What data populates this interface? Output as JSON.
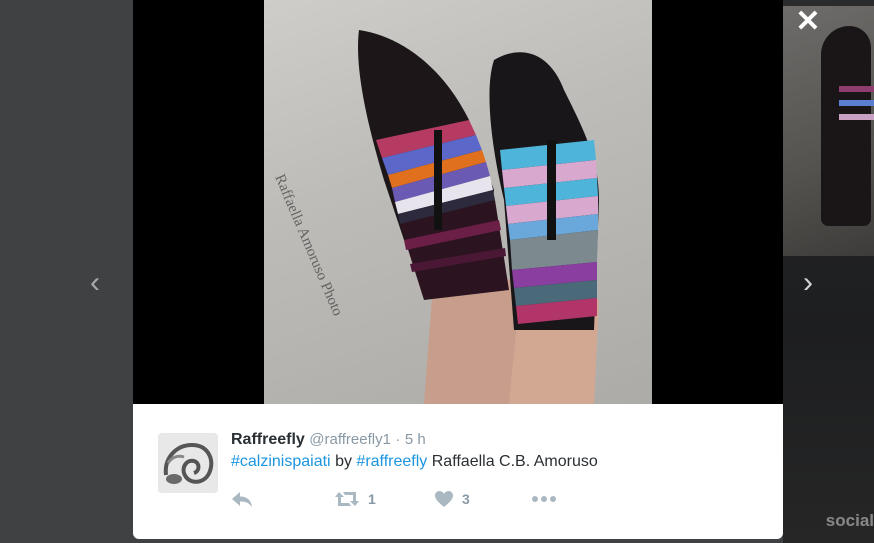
{
  "media": {
    "watermark": "Raffaella Amoruso Photo"
  },
  "navigation": {
    "prev_glyph": "‹",
    "next_glyph": "›",
    "close_glyph": "✕"
  },
  "background": {
    "corner_mark": "social"
  },
  "tweet": {
    "display_name": "Raffreefly",
    "handle": "@raffreefly1",
    "separator": "·",
    "timestamp": "5 h",
    "text": {
      "hashtag1": "#calzinispaiati",
      "by": "by",
      "hashtag2": "#raffreefly",
      "tail": "Raffaella C.B. Amoruso"
    },
    "actions": {
      "reply_icon": "reply-icon",
      "retweet_icon": "retweet-icon",
      "retweet_count": "1",
      "like_icon": "heart-icon",
      "like_count": "3",
      "more_icon": "more-icon"
    }
  },
  "colors": {
    "link": "#1b95e0",
    "action_gray": "#aab8c2",
    "name": "#292f33",
    "secondary": "#8899a6"
  }
}
